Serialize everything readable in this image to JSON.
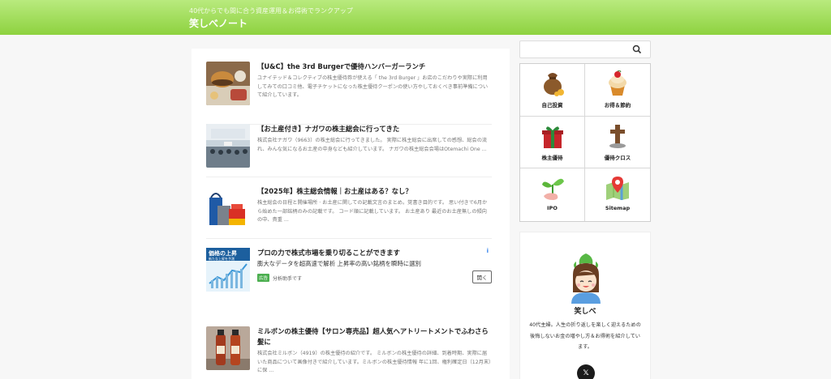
{
  "header": {
    "tagline": "40代からでも間に合う資産運用＆お得術でランクアップ",
    "site_title": "笑しべノート"
  },
  "posts": [
    {
      "title": "【U&C】the 3rd Burgerで優待ハンバーガーランチ",
      "excerpt": "ユナイテッド＆コレクティブの株主優待券が使える「 the 3rd Burger 」お店のこだわりや実際に利用してみての口コミ他、電子チケットになった株主優待クーポンの使い方やしておくべき事前準備について紹介しています。"
    },
    {
      "title": "【お土産付き】ナガワの株主総会に行ってきた",
      "excerpt": "株式会社ナガワ（9663）の株主総会に行ってきました。 実際に株主総会に出席しての感想、総会の流れ、みんな気になるお土産の中身なども紹介しています。 ナガワの株主総会会場はOtemachi One ..."
    },
    {
      "title": "【2025年】株主総会情報｜お土産はある？なし？",
      "excerpt": "株主総会の日程と開催場所 · お土産に関しての記載文言のまとめ。覚書き目的です。 思い付きで6月から始めた一部銘柄のみの記載です。 コード順に記載しています。 お土産あり 最近のお土産無しの傾向の中、貴重 ..."
    },
    {
      "title": "ミルボンの株主優待【サロン専売品】超人気ヘアトリートメントでふわさら髪に",
      "excerpt": "株式会社ミルボン（4919）の株主優待の紹介です。 ミルボンの株主優待の詳細、到着時期、実際に届いた商品について画像付きで紹介しています。ミルボンの株主優待情報 年に1回、権利確定日（12月末）に保 ..."
    }
  ],
  "ad": {
    "thumb_line1": "価格の上昇",
    "thumb_line2": "新たな上昇を予測",
    "title": "プロの力で株式市場を乗り切ることができます",
    "subtitle": "膨大なデータを超高速で解析 上昇率の高い銘柄を瞬時に選別",
    "badge": "広告",
    "advertiser": "分析助手です",
    "info_icon": "i",
    "open_label": "開く"
  },
  "search": {
    "placeholder": "",
    "icon": "search-icon"
  },
  "categories": [
    {
      "label": "自己投資",
      "icon": "money-bag-icon"
    },
    {
      "label": "お得＆節約",
      "icon": "cupcake-icon"
    },
    {
      "label": "株主優待",
      "icon": "gift-icon"
    },
    {
      "label": "優待クロス",
      "icon": "cross-icon"
    },
    {
      "label": "IPO",
      "icon": "sprout-icon"
    },
    {
      "label": "Sitemap",
      "icon": "map-pin-icon"
    }
  ],
  "profile": {
    "name": "笑しべ",
    "desc": "40代主婦。人生の折り返しを楽しく迎えるための後悔しないお金の増やし方＆お得術を紹介しています。",
    "x_label": "𝕏"
  },
  "colors": {
    "header_top": "#b9ea7e",
    "header_bottom": "#8ed23f",
    "ad_badge": "#4caf50",
    "ad_info": "#2f80ed"
  }
}
